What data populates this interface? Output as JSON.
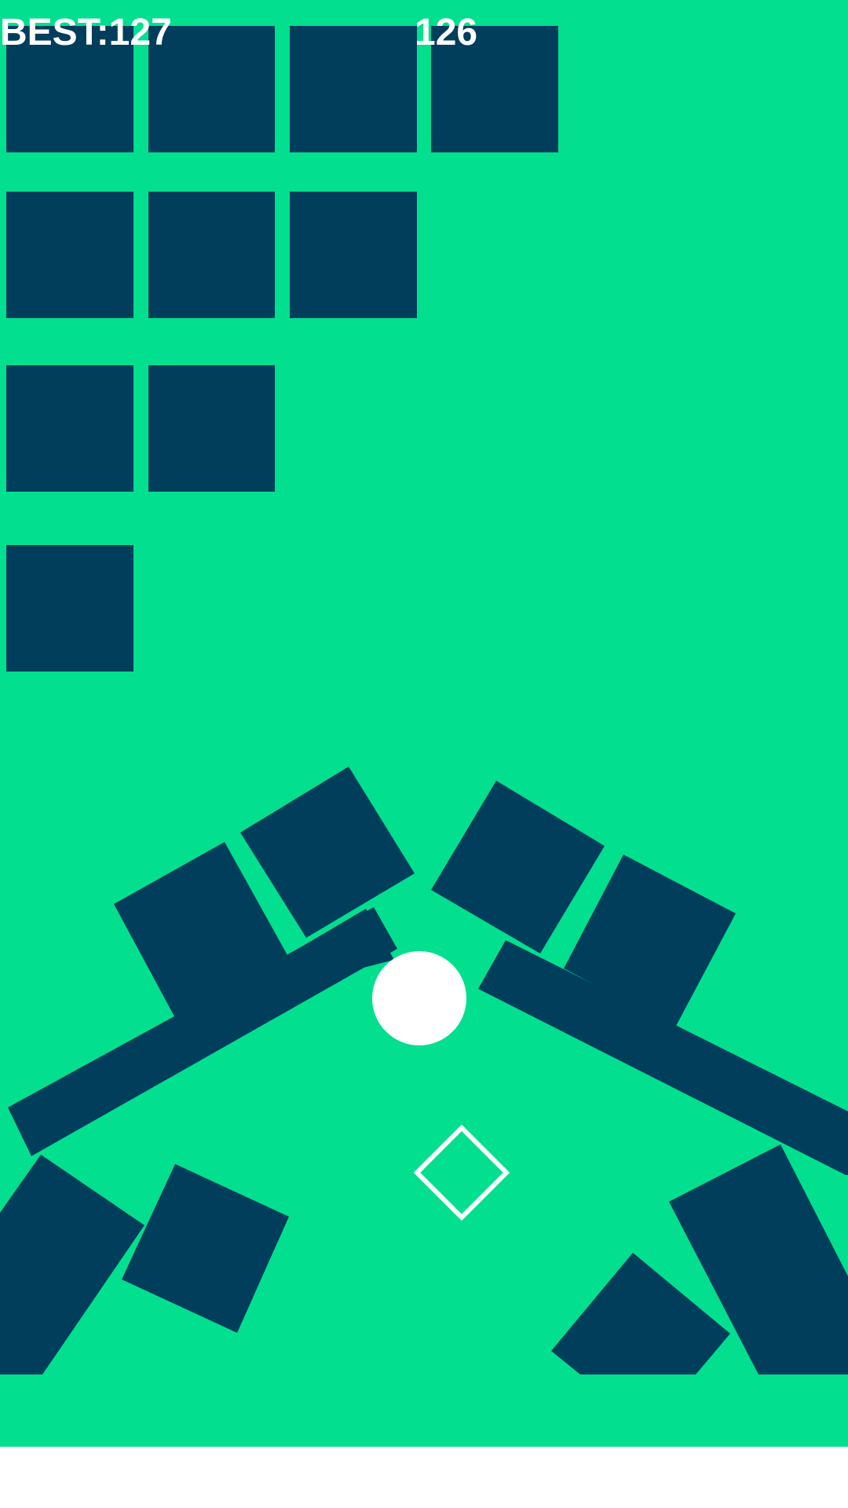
{
  "hud": {
    "best_label": "BEST:127",
    "score": "126"
  },
  "colors": {
    "background": "#02df8f",
    "block": "#003e5c",
    "player": "#ffffff",
    "outer": "#ffffff"
  },
  "icons": {
    "player": "ball",
    "target": "diamond-outline-icon"
  }
}
